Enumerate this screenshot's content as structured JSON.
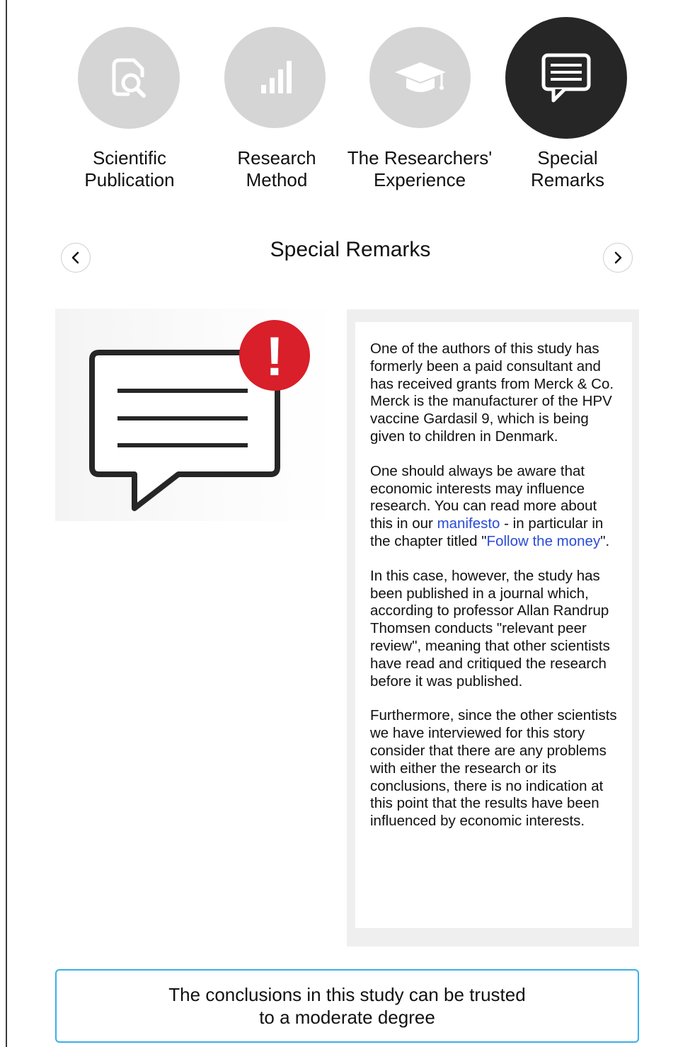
{
  "tabs": [
    {
      "label": "Scientific\nPublication",
      "icon": "document-search-icon",
      "active": false
    },
    {
      "label": "Research\nMethod",
      "icon": "bar-chart-icon",
      "active": false
    },
    {
      "label": "The Researchers'\nExperience",
      "icon": "graduation-cap-icon",
      "active": false
    },
    {
      "label": "Special\nRemarks",
      "icon": "chat-message-icon",
      "active": true
    }
  ],
  "section": {
    "title": "Special Remarks",
    "prev_icon": "chevron-left-icon",
    "next_icon": "chevron-right-icon"
  },
  "illustration": {
    "icon": "chat-alert-icon",
    "alert_mark": "!"
  },
  "remarks": {
    "p1": "One of the authors of this study has formerly been a paid consultant and has received grants from Merck & Co. Merck is the manufacturer of the HPV vaccine Gardasil 9, which is being given to children in Denmark.",
    "p2_before": "One should always be aware that economic interests may influence research. You can read more about this in our ",
    "p2_link1": "manifesto",
    "p2_middle": " - in particular in the chapter titled \"",
    "p2_link2": "Follow the money",
    "p2_after": "\".",
    "p3": "In this case, however, the study has been published in a journal which, according to professor Allan Randrup Thomsen conducts \"relevant peer review\", meaning that other scientists have read and critiqued the research before it was published.",
    "p4": "Furthermore, since the other scientists we have interviewed for this story consider that there are any problems with either the research or its conclusions, there is no indication at this point that the results have been influenced by economic interests."
  },
  "verdict": {
    "text": "The conclusions in this study can be trusted to a moderate degree"
  },
  "colors": {
    "active_tab": "#262626",
    "inactive_tab": "#d5d5d5",
    "alert_red": "#d81f2a",
    "verdict_border": "#38b0e8",
    "link": "#2a4bd6"
  }
}
